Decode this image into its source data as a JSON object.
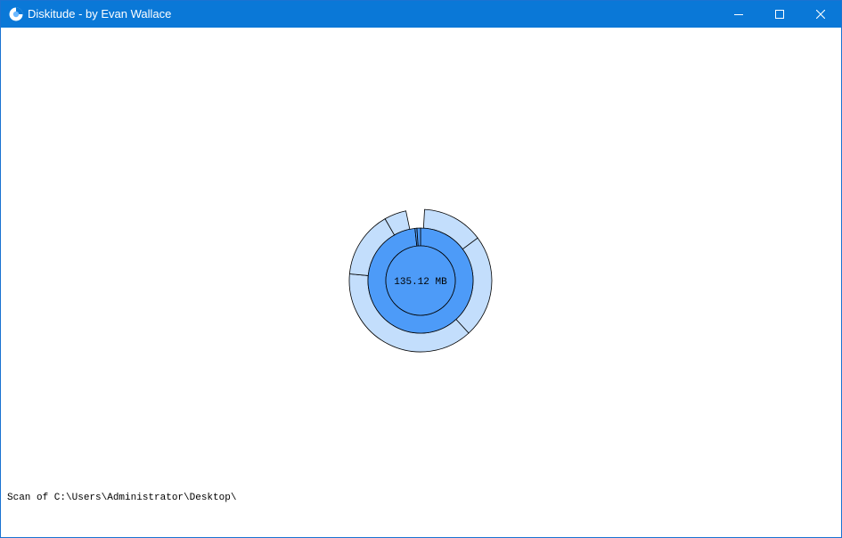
{
  "window": {
    "title": "Diskitude - by Evan Wallace",
    "title_bar_color": "#0a78d7",
    "icons": {
      "app": "diskitude-pie-icon",
      "minimize": "minimize-icon",
      "maximize": "maximize-icon",
      "close": "close-icon"
    }
  },
  "chart_data": {
    "type": "sunburst",
    "center_label": "135.12 MB",
    "colors": {
      "inner": "#4d9bf8",
      "outer": "#c3defc",
      "stroke": "#000000"
    },
    "inner_ring": [
      {
        "start_fraction": 0.0,
        "end_fraction": 0.983
      },
      {
        "start_fraction": 0.983,
        "end_fraction": 0.989
      },
      {
        "start_fraction": 0.989,
        "end_fraction": 1.0
      }
    ],
    "outer_ring": [
      {
        "start_fraction": 0.009,
        "end_fraction": 0.148
      },
      {
        "start_fraction": 0.148,
        "end_fraction": 0.382
      },
      {
        "start_fraction": 0.382,
        "end_fraction": 0.765
      },
      {
        "start_fraction": 0.765,
        "end_fraction": 0.917
      },
      {
        "start_fraction": 0.917,
        "end_fraction": 0.967
      }
    ]
  },
  "status": {
    "text": "Scan of C:\\Users\\Administrator\\Desktop\\"
  }
}
